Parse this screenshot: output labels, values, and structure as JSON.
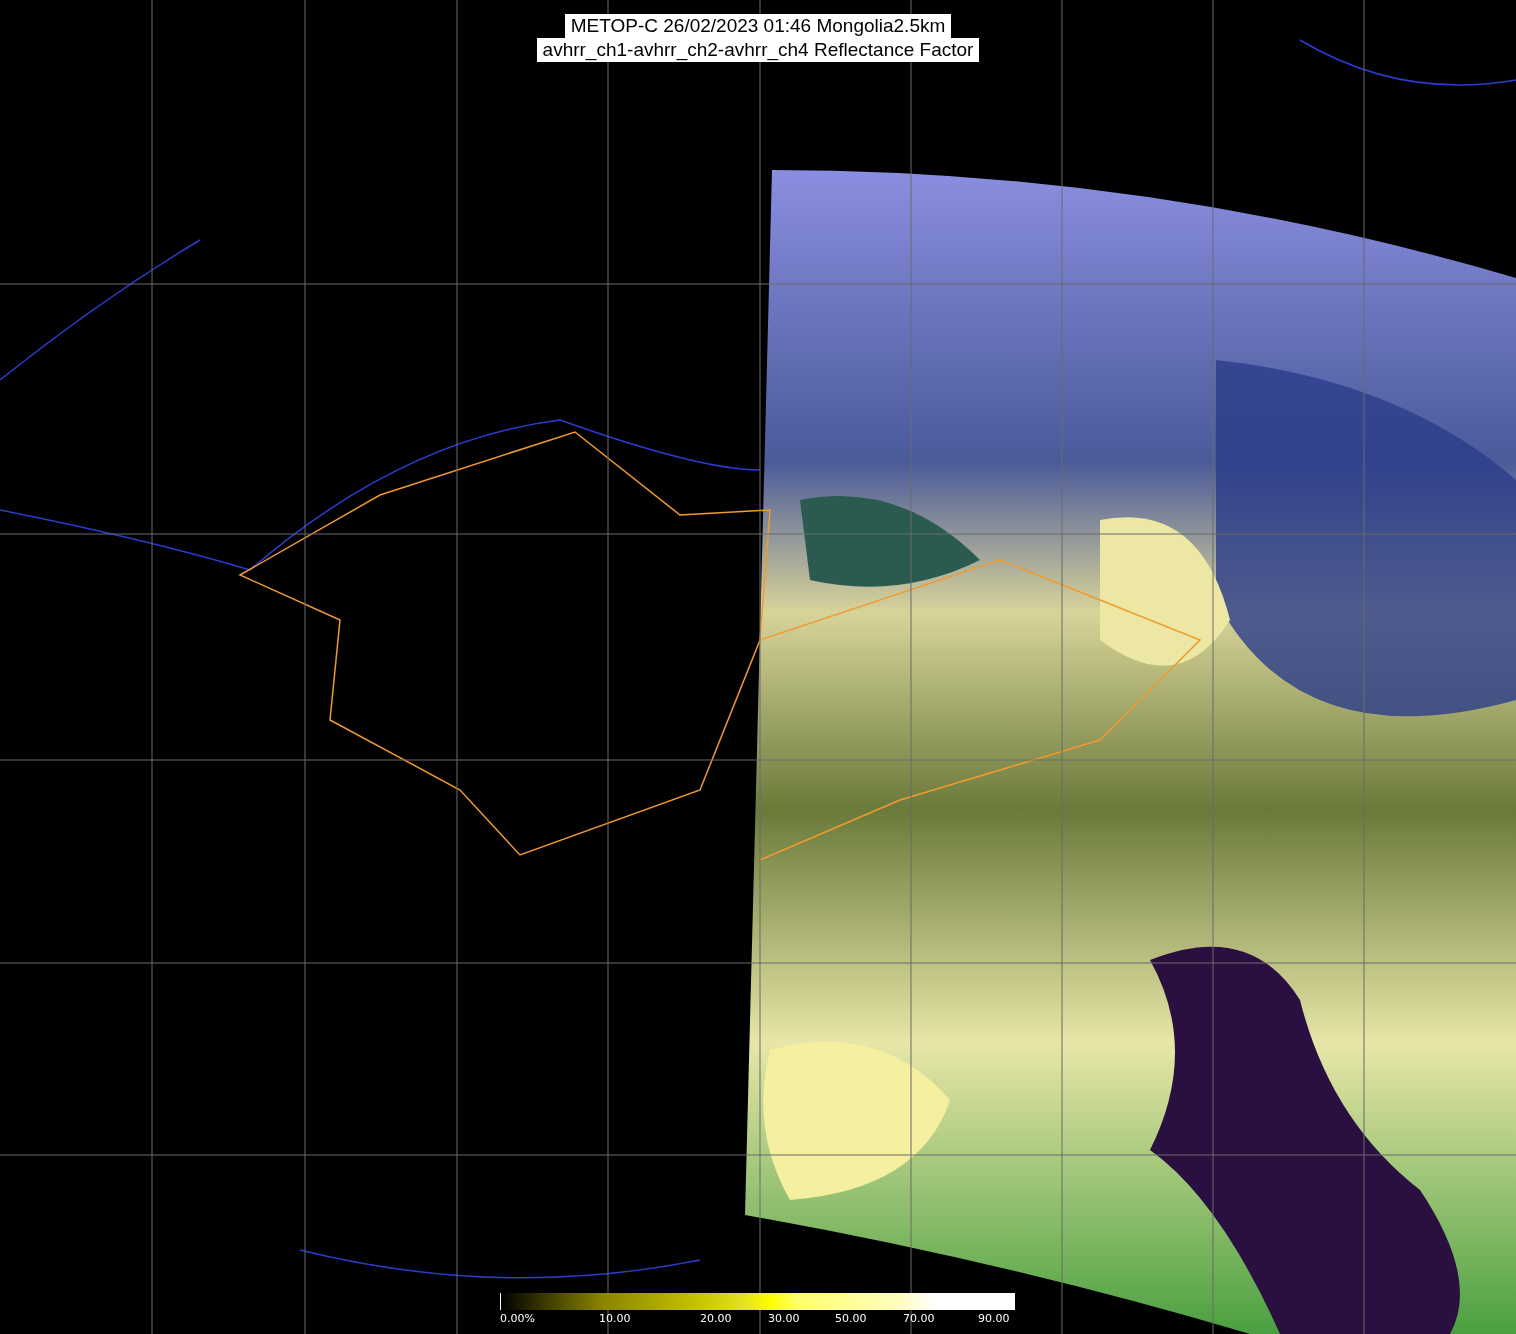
{
  "title": {
    "line_1": "METOP-C 26/02/2023 01:46 Mongolia2.5km",
    "line_2": "avhrr_ch1-avhrr_ch2-avhrr_ch4 Reflectance Factor"
  },
  "colorbar": {
    "labels": [
      "0.00%",
      "10.00",
      "20.00",
      "30.00",
      "50.00",
      "70.00",
      "90.00"
    ]
  }
}
